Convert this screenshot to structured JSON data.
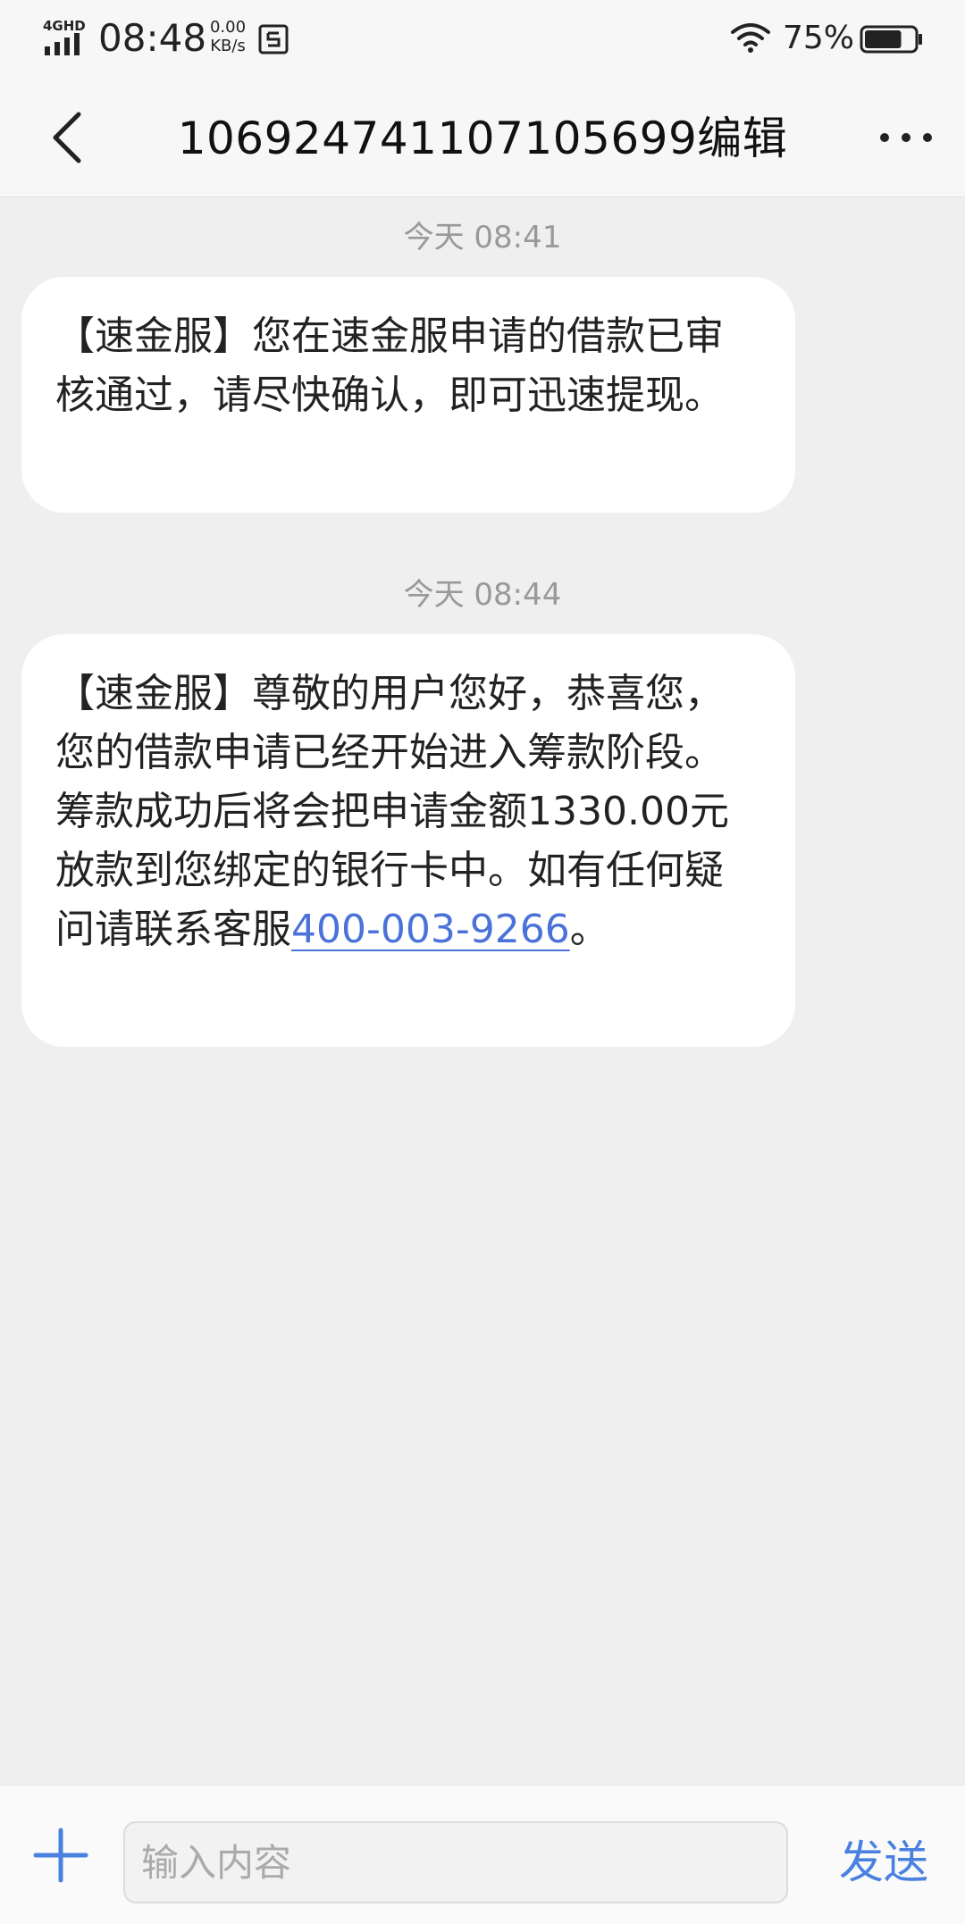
{
  "status_bar": {
    "network": "4GHD",
    "time": "08:48",
    "speed_value": "0.00",
    "speed_unit": "KB/s",
    "battery_percent": "75%",
    "battery_level": 0.75
  },
  "header": {
    "title": "1069247411071056​99编辑",
    "back_icon": "chevron-left-icon",
    "more_icon": "more-horizontal-icon"
  },
  "messages": [
    {
      "timestamp": "今天 08:41",
      "text": "【速金服】您在速金服申请的借款已审核通过，请尽快确认，即可迅速提现。"
    },
    {
      "timestamp": "今天 08:44",
      "text": "【速金服】尊敬的用户您好，恭喜您，您的借款申请已经开始进入筹款阶段。筹款成功后将会把申请金额1330.00元放款到您绑定的银行卡中。如有任何疑问请联系客服",
      "phone": "400-003-9266",
      "suffix": "。"
    }
  ],
  "input_bar": {
    "placeholder": "输入内容",
    "value": "",
    "send_label": "发送",
    "add_icon": "plus-icon"
  },
  "colors": {
    "accent": "#4a80e0",
    "link": "#4a72d8",
    "background": "#efefef"
  }
}
